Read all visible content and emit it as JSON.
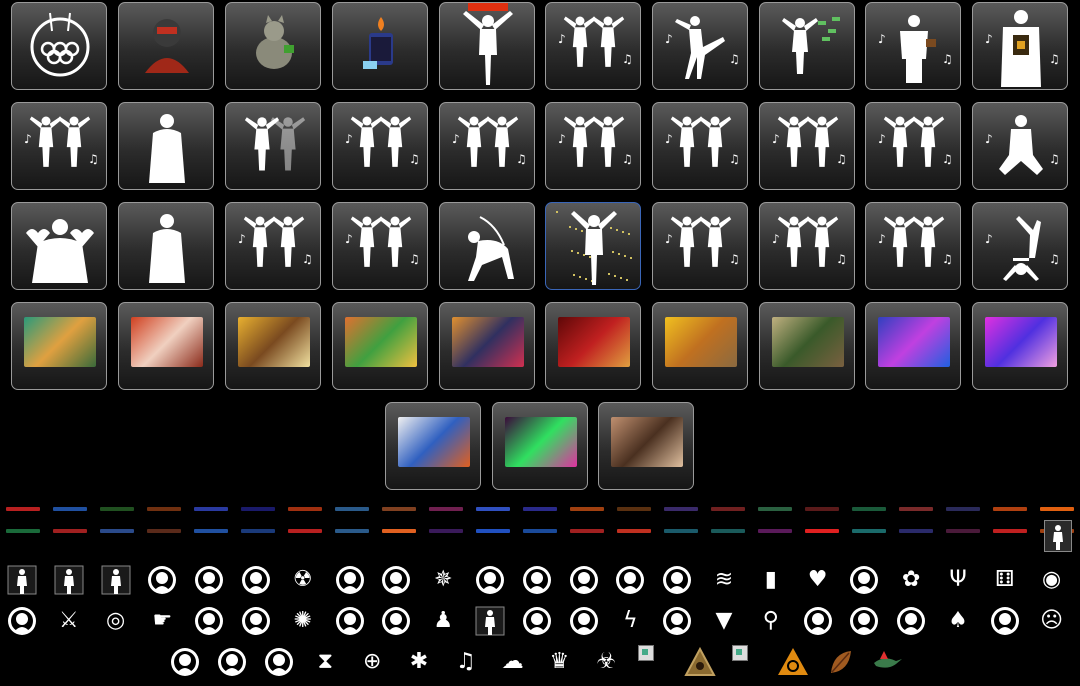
{
  "emote_tiles": [
    {
      "name": "olympic-rings-icon",
      "kind": "rings"
    },
    {
      "name": "helmet-avatar-icon",
      "kind": "helmet"
    },
    {
      "name": "cat-icon",
      "kind": "cat"
    },
    {
      "name": "lighter-icon",
      "kind": "lighter"
    },
    {
      "name": "dancer-banner-icon",
      "kind": "tpose"
    },
    {
      "name": "dance-duo-icon",
      "kind": "duo"
    },
    {
      "name": "kick-dance-icon",
      "kind": "kick"
    },
    {
      "name": "money-throw-icon",
      "kind": "money"
    },
    {
      "name": "coffee-dance-icon",
      "kind": "coffee"
    },
    {
      "name": "jacket-dance-icon",
      "kind": "jacket"
    },
    {
      "name": "dance-duo-icon",
      "kind": "duo"
    },
    {
      "name": "heart-hands-icon",
      "kind": "single"
    },
    {
      "name": "shadow-duo-icon",
      "kind": "shadow"
    },
    {
      "name": "dance-duo-icon",
      "kind": "duo"
    },
    {
      "name": "dance-duo-icon",
      "kind": "duo"
    },
    {
      "name": "dance-duo-icon",
      "kind": "duo"
    },
    {
      "name": "dance-duo-icon",
      "kind": "duo"
    },
    {
      "name": "kick-duo-icon",
      "kind": "duo"
    },
    {
      "name": "dance-duo-icon",
      "kind": "duo"
    },
    {
      "name": "kneel-dance-icon",
      "kind": "kneel"
    },
    {
      "name": "hearts-hug-icon",
      "kind": "hug"
    },
    {
      "name": "solo-dance-icon",
      "kind": "single"
    },
    {
      "name": "dance-duo-icon",
      "kind": "duo"
    },
    {
      "name": "dance-duo-icon",
      "kind": "duo"
    },
    {
      "name": "crawl-icon",
      "kind": "crawl"
    },
    {
      "name": "confetti-dancer-icon",
      "kind": "confetti",
      "selected": true
    },
    {
      "name": "dance-duo-icon",
      "kind": "duo"
    },
    {
      "name": "dance-duo-icon",
      "kind": "duo"
    },
    {
      "name": "dance-duo-icon",
      "kind": "duo"
    },
    {
      "name": "handstand-icon",
      "kind": "handstand"
    },
    {
      "name": "dragons-art",
      "kind": "pic",
      "colors": [
        "#2a9a7a",
        "#e0a040",
        "#3a6a3a"
      ]
    },
    {
      "name": "red-creature-art",
      "kind": "pic",
      "colors": [
        "#d04020",
        "#f0d0c0",
        "#8a2a1a"
      ]
    },
    {
      "name": "yellow-duck-art",
      "kind": "pic",
      "colors": [
        "#e8b030",
        "#7a4a20",
        "#f0e0a0"
      ]
    },
    {
      "name": "cartoon-party-art",
      "kind": "pic",
      "colors": [
        "#e07030",
        "#40a040",
        "#f0c040"
      ]
    },
    {
      "name": "panther-art",
      "kind": "pic",
      "colors": [
        "#e09030",
        "#303060",
        "#d03050"
      ]
    },
    {
      "name": "bullet-art",
      "kind": "pic",
      "colors": [
        "#600808",
        "#c02020",
        "#e0a040"
      ]
    },
    {
      "name": "sunlight-art",
      "kind": "pic",
      "colors": [
        "#f0c020",
        "#c07020",
        "#8a6a40"
      ]
    },
    {
      "name": "cards-art",
      "kind": "pic",
      "colors": [
        "#c0b080",
        "#3a5a2a",
        "#7a6040"
      ]
    },
    {
      "name": "concert-art",
      "kind": "pic",
      "colors": [
        "#3040c0",
        "#c040e0",
        "#2060e0"
      ]
    },
    {
      "name": "neon-dancer-art",
      "kind": "pic",
      "colors": [
        "#e030e0",
        "#5030e0",
        "#f0a0e0"
      ]
    },
    {
      "name": "snowman-art",
      "kind": "pic",
      "colors": [
        "#f0f0f0",
        "#3060c0",
        "#e06020"
      ]
    },
    {
      "name": "game-over-art",
      "kind": "pic",
      "colors": [
        "#3a0a3a",
        "#30e060",
        "#e030a0"
      ]
    },
    {
      "name": "sunglasses-woman-art",
      "kind": "pic",
      "colors": [
        "#c09070",
        "#4a3020",
        "#e0c0a0"
      ]
    }
  ],
  "strip_colors_1": [
    "#b82020",
    "#2050a0",
    "#205020",
    "#703010",
    "#2a3aa0",
    "#1a1a6a",
    "#a03010",
    "#2a5a8a",
    "#804020",
    "#702050",
    "#3050c0",
    "#2a2a8a",
    "#a04010",
    "#5a3010",
    "#3a2a6a",
    "#702020",
    "#2a6040",
    "#5a1a1a",
    "#1a5a3a",
    "#7a2a2a",
    "#2a2a5a",
    "#b04010",
    "#e06010"
  ],
  "strip_colors_2": [
    "#1a6a3a",
    "#a02020",
    "#2a4a8a",
    "#5a2a1a",
    "#2050a0",
    "#1a3a7a",
    "#b82020",
    "#2a5a8a",
    "#e06020",
    "#3a1a5a",
    "#2050c0",
    "#1a4a9a",
    "#a02020",
    "#c03020",
    "#1a5a6a",
    "#1a5a5a",
    "#5a1a5a",
    "#e02020",
    "#1a6a6a",
    "#2a2a6a",
    "#4a1a3a",
    "#c02020",
    "#a04010"
  ],
  "icon_rows": [
    [
      "person-frame-icon",
      "person-frame-icon",
      "person-frame-icon",
      "gasmask-hands-icon",
      "alien-head-icon",
      "bust-icon",
      "radiation-icon",
      "trex-icon",
      "paw-icon",
      "octopus-icon",
      "skull-mask-icon",
      "hockey-mask-icon",
      "boxing-gloves-icon",
      "gas-mask-icon",
      "voodoo-doll-icon",
      "claw-marks-icon",
      "tombstone-icon",
      "heart-swords-icon",
      "beetle-icon",
      "revolver-cylinder-icon",
      "trident-icon",
      "dice-icon",
      "lifebuoy-icon"
    ],
    [
      "dragon-spiral-icon",
      "crossed-swords-icon",
      "donut-icon",
      "pointing-hand-icon",
      "fox-face-icon",
      "brain-head-icon",
      "scorpion-icon",
      "eagle-icon",
      "wolf-moon-icon",
      "chess-pawn-icon",
      "standing-figure-icon",
      "crossed-arrows-icon",
      "spartan-helmet-icon",
      "lightning-bolt-icon",
      "shield-chevron-icon",
      "pizza-icon",
      "magnifier-icon",
      "bear-icon",
      "horseshoe-clover-icon",
      "flexed-arm-icon",
      "playing-cards-icon",
      "grim-reaper-icon",
      "smiley-x-icon"
    ],
    [
      "heart-badge-icon",
      "rooster-icon",
      "baby-face-icon",
      "hourglass-icon",
      "crosshair-icon",
      "spider-icon",
      "bird-icon",
      "ghost-icon",
      "crown-icon",
      "biohazard-icon",
      "broken-image-icon",
      "triangle-emblem-icon",
      "broken-image-icon",
      "warning-hazard-icon",
      "leaf-icon",
      "hummingbird-icon"
    ]
  ],
  "accent_colors": {
    "tile_border": "#9a9a9a",
    "selected_border": "#3a66b8",
    "background": "#000000"
  }
}
